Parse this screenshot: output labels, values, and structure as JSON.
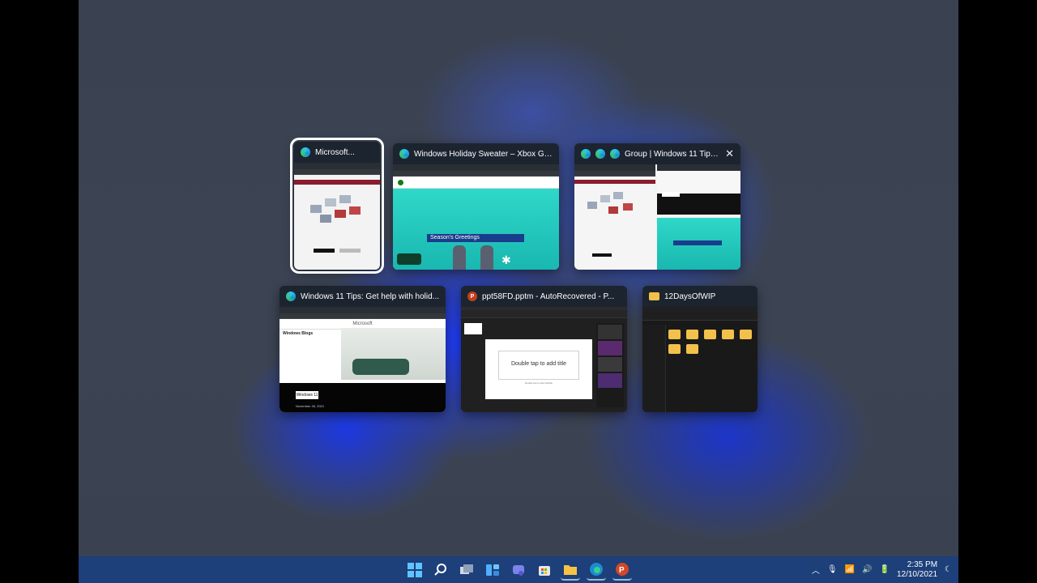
{
  "windows": [
    {
      "title": "Microsoft...",
      "icon": "edge-icon",
      "selected": true
    },
    {
      "title": "Windows Holiday Sweater – Xbox Ge...",
      "icon": "edge-icon"
    },
    {
      "title": "Group | Windows 11 Tips: Get...",
      "icon": "edge-icon",
      "close": "✕"
    },
    {
      "title": "Windows 11 Tips: Get help with holid...",
      "icon": "edge-icon"
    },
    {
      "title": "ppt58FD.pptm  -  AutoRecovered - P...",
      "icon": "powerpoint-icon"
    },
    {
      "title": "12DaysOfWIP",
      "icon": "folder-icon"
    }
  ],
  "thumbs": {
    "xbox_banner": "Season's Greetings",
    "ppt_placeholder": "Double tap to add title",
    "ppt_sub": "Double tap to add subtitle",
    "win11_button": "Windows 11",
    "win11_date": "November 26, 2021",
    "win_blogs": "Windows Blogs",
    "ms_brand": "Microsoft"
  },
  "taskbar": {
    "apps": [
      "start-icon",
      "search-icon",
      "task-view-icon",
      "widgets-icon",
      "teams-chat-icon",
      "store-icon",
      "file-explorer-icon",
      "edge-icon",
      "powerpoint-icon"
    ],
    "time": "2:35 PM",
    "date": "12/10/2021",
    "accent": "#1d3f7a"
  }
}
